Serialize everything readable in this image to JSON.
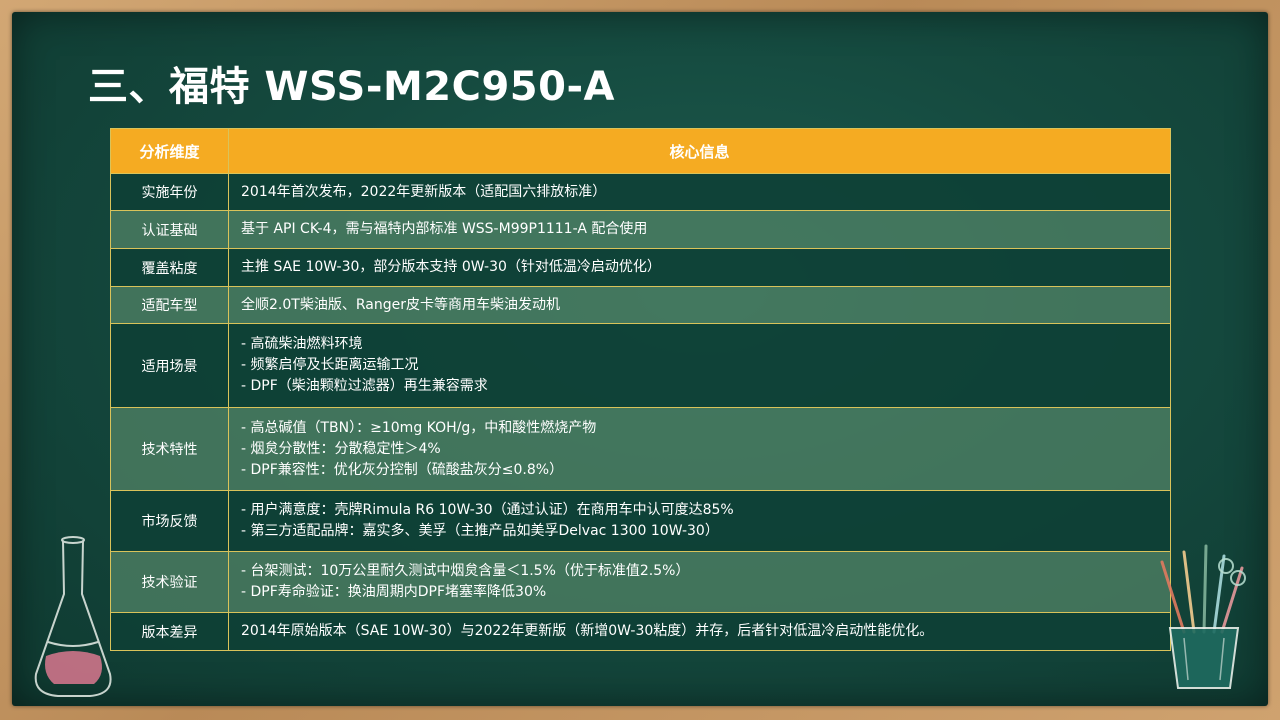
{
  "slide": {
    "title": "三、福特 WSS-M2C950-A"
  },
  "table": {
    "headers": [
      "分析维度",
      "核心信息"
    ],
    "rows": [
      {
        "dimension": "实施年份",
        "lines": [
          "2014年首次发布，2022年更新版本（适配国六排放标准）"
        ]
      },
      {
        "dimension": "认证基础",
        "lines": [
          "基于 API CK-4，需与福特内部标准 WSS-M99P1111-A 配合使用"
        ]
      },
      {
        "dimension": "覆盖粘度",
        "lines": [
          "主推 SAE 10W-30，部分版本支持 0W-30（针对低温冷启动优化）"
        ]
      },
      {
        "dimension": "适配车型",
        "lines": [
          "全顺2.0T柴油版、Ranger皮卡等商用车柴油发动机"
        ]
      },
      {
        "dimension": "适用场景",
        "lines": [
          "- 高硫柴油燃料环境",
          "- 频繁启停及长距离运输工况",
          "- DPF（柴油颗粒过滤器）再生兼容需求"
        ]
      },
      {
        "dimension": "技术特性",
        "lines": [
          "- 高总碱值（TBN）：≥10mg KOH/g，中和酸性燃烧产物",
          "- 烟炱分散性：分散稳定性＞4%",
          "- DPF兼容性：优化灰分控制（硫酸盐灰分≤0.8%）"
        ]
      },
      {
        "dimension": "市场反馈",
        "lines": [
          "- 用户满意度：壳牌Rimula R6 10W-30（通过认证）在商用车中认可度达85%",
          "- 第三方适配品牌：嘉实多、美孚（主推产品如美孚Delvac 1300 10W-30）"
        ]
      },
      {
        "dimension": "技术验证",
        "lines": [
          "- 台架测试：10万公里耐久测试中烟炱含量＜1.5%（优于标准值2.5%）",
          "- DPF寿命验证：换油周期内DPF堵塞率降低30%"
        ]
      },
      {
        "dimension": "版本差异",
        "lines": [
          "2014年原始版本（SAE 10W-30）与2022年更新版（新增0W-30粘度）并存，后者针对低温冷启动性能优化。"
        ]
      }
    ]
  },
  "decorations": {
    "flask_icon": "flask-icon",
    "pencil_cup_icon": "pencil-cup-icon"
  },
  "colors": {
    "header_bg": "#f5ab22",
    "board_bg": "#154a3f",
    "frame": "#c89b66"
  }
}
